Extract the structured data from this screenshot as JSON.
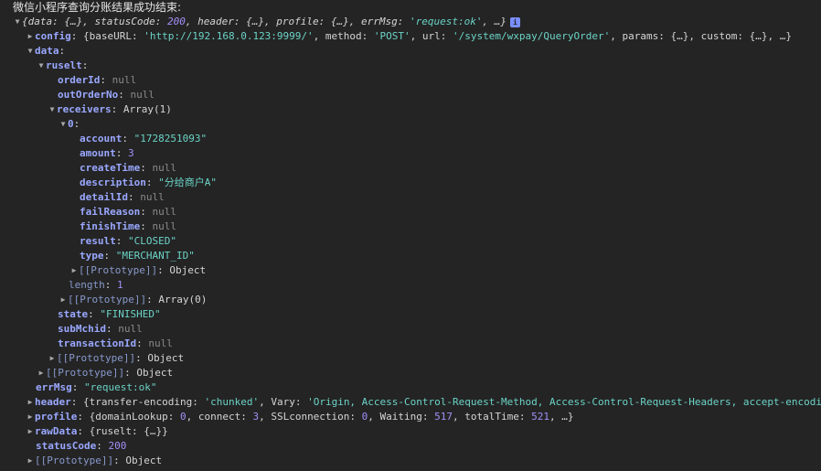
{
  "log_title": "微信小程序查询分账结果成功结束:",
  "summary": {
    "open": "{",
    "data_key": "data",
    "data_val": "{…}",
    "status_key": "statusCode",
    "status_val": "200",
    "header_key": "header",
    "header_val": "{…}",
    "profile_key": "profile",
    "profile_val": "{…}",
    "errmsg_key": "errMsg",
    "errmsg_val": "'request:ok'",
    "tail": ", …}",
    "info_badge": "i"
  },
  "config": {
    "key": "config",
    "open": "{",
    "baseurl_key": "baseURL",
    "baseurl_val": "'http://192.168.0.123:9999/'",
    "method_key": "method",
    "method_val": "'POST'",
    "url_key": "url",
    "url_val": "'/system/wxpay/QueryOrder'",
    "params_key": "params",
    "params_val": "{…}",
    "custom_key": "custom",
    "custom_val": "{…}",
    "tail": ", …}"
  },
  "data": {
    "key": "data",
    "ruselt_key": "ruselt",
    "orderId_key": "orderId",
    "orderId_val": "null",
    "outOrderNo_key": "outOrderNo",
    "outOrderNo_val": "null",
    "receivers_key": "receivers",
    "receivers_val": "Array(1)",
    "item0_key": "0",
    "account_key": "account",
    "account_val": "\"1728251093\"",
    "amount_key": "amount",
    "amount_val": "3",
    "createTime_key": "createTime",
    "createTime_val": "null",
    "description_key": "description",
    "description_val": "\"分给商户A\"",
    "detailId_key": "detailId",
    "detailId_val": "null",
    "failReason_key": "failReason",
    "failReason_val": "null",
    "finishTime_key": "finishTime",
    "finishTime_val": "null",
    "result_key": "result",
    "result_val": "\"CLOSED\"",
    "type_key": "type",
    "type_val": "\"MERCHANT_ID\"",
    "proto_obj_key": "[[Prototype]]",
    "proto_obj_val": "Object",
    "proto_arr_key": "[[Prototype]]",
    "proto_arr_val": "Array(0)",
    "length_key": "length",
    "length_val": "1",
    "state_key": "state",
    "state_val": "\"FINISHED\"",
    "subMchid_key": "subMchid",
    "subMchid_val": "null",
    "transactionId_key": "transactionId",
    "transactionId_val": "null",
    "proto_ruselt_key": "[[Prototype]]",
    "proto_ruselt_val": "Object",
    "proto_data_key": "[[Prototype]]",
    "proto_data_val": "Object",
    "errMsg_key": "errMsg",
    "errMsg_val": "\"request:ok\""
  },
  "header": {
    "key": "header",
    "open": "{",
    "te_key": "transfer-encoding",
    "te_val": "'chunked'",
    "vary_key": "Vary",
    "vary_val": "'Origin, Access-Control-Request-Method, Access-Control-Request-Headers, accept-encodin"
  },
  "profile": {
    "key": "profile",
    "open": "{",
    "dl_key": "domainLookup",
    "dl_val": "0",
    "conn_key": "connect",
    "conn_val": "3",
    "ssl_key": "SSLconnection",
    "ssl_val": "0",
    "wait_key": "Waiting",
    "wait_val": "517",
    "total_key": "totalTime",
    "total_val": "521",
    "tail": ", …}"
  },
  "rawData": {
    "key": "rawData",
    "open": "{",
    "ruselt_key": "ruselt",
    "ruselt_val": "{…}",
    "close": "}"
  },
  "statusCode": {
    "key": "statusCode",
    "val": "200"
  },
  "root_proto": {
    "key": "[[Prototype]]",
    "val": "Object"
  },
  "glyphs": {
    "open": "▼",
    "closed": "▶",
    "colon": ": ",
    "comma": ", "
  },
  "colors": {
    "background": "#242424",
    "key": "#9aa8ff",
    "string": "#6bd3c6",
    "quoted_string": "#e07c7c",
    "number": "#a48ff8",
    "null": "#8a8a8a",
    "text": "#d5d5d5",
    "badge": "#7a8fff"
  }
}
